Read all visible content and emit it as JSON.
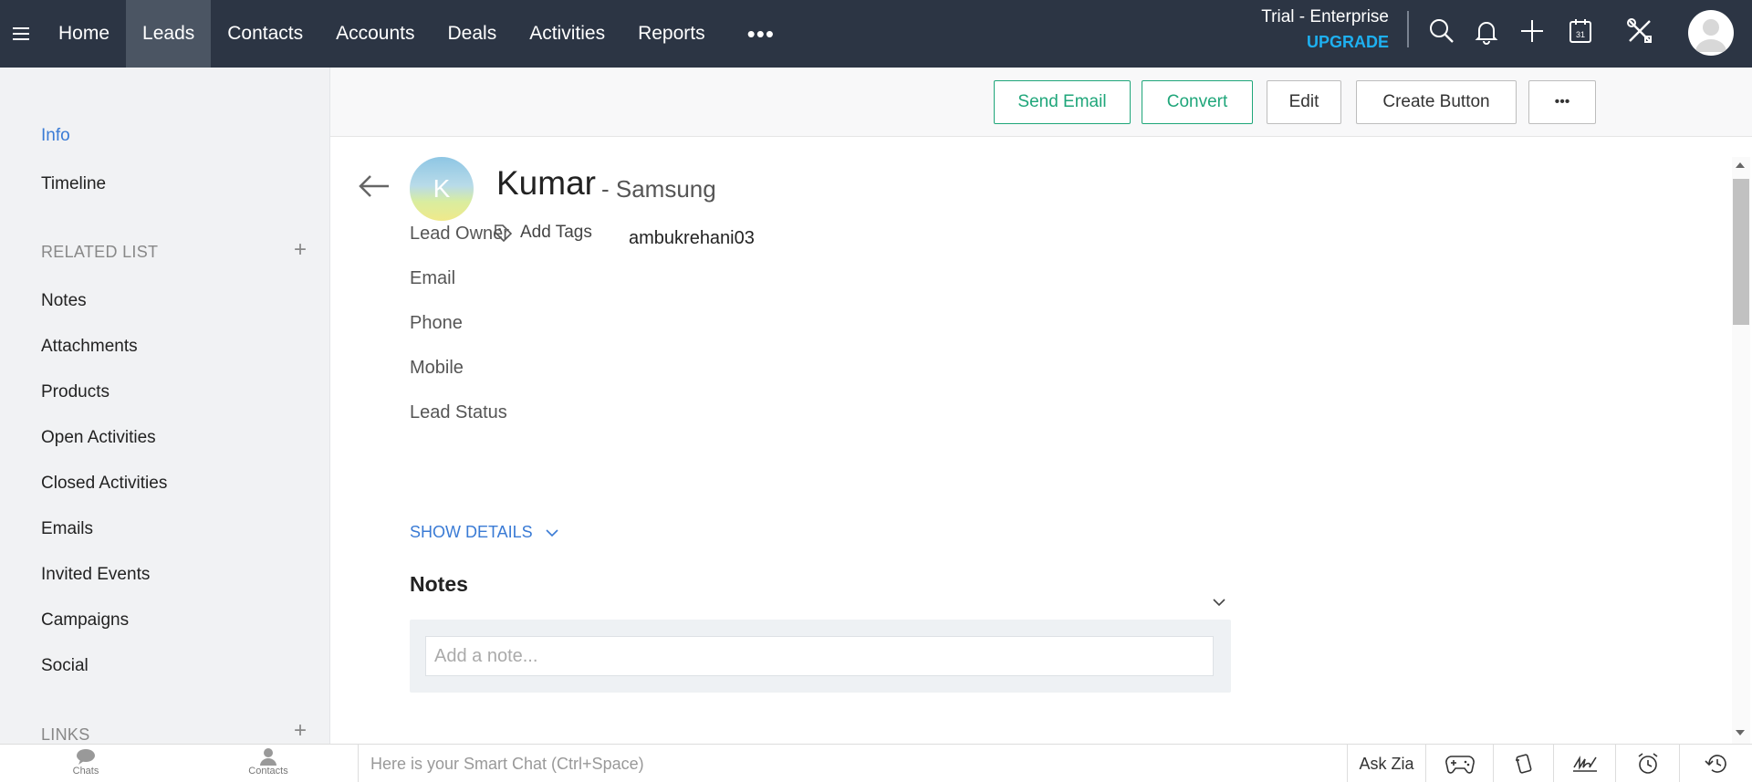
{
  "topnav": {
    "items": [
      {
        "label": "Home",
        "active": false
      },
      {
        "label": "Leads",
        "active": true
      },
      {
        "label": "Contacts",
        "active": false
      },
      {
        "label": "Accounts",
        "active": false
      },
      {
        "label": "Deals",
        "active": false
      },
      {
        "label": "Activities",
        "active": false
      },
      {
        "label": "Reports",
        "active": false
      }
    ],
    "more": "•••",
    "trial_label": "Trial - Enterprise",
    "upgrade_label": "UPGRADE",
    "icons": [
      "search-icon",
      "bell-icon",
      "plus-icon",
      "calendar-icon",
      "tools-icon"
    ],
    "calendar_day": "31"
  },
  "sidebar": {
    "info": "Info",
    "timeline": "Timeline",
    "related_list_title": "RELATED LIST",
    "related_items": [
      "Notes",
      "Attachments",
      "Products",
      "Open Activities",
      "Closed Activities",
      "Emails",
      "Invited Events",
      "Campaigns",
      "Social"
    ],
    "links_title": "LINKS"
  },
  "actions": {
    "send_email": "Send Email",
    "convert": "Convert",
    "edit": "Edit",
    "create_button": "Create Button",
    "more": "•••"
  },
  "lead": {
    "initial": "K",
    "name": "Kumar",
    "company": "- Samsung",
    "add_tags": "Add Tags",
    "fields": [
      {
        "label": "Lead Owner",
        "value": "ambukrehani03"
      },
      {
        "label": "Email",
        "value": ""
      },
      {
        "label": "Phone",
        "value": ""
      },
      {
        "label": "Mobile",
        "value": ""
      },
      {
        "label": "Lead Status",
        "value": ""
      }
    ],
    "show_details": "SHOW DETAILS"
  },
  "notes": {
    "title": "Notes",
    "placeholder": "Add a note..."
  },
  "bottombar": {
    "chats": "Chats",
    "contacts": "Contacts",
    "smartchat_placeholder": "Here is your Smart Chat (Ctrl+Space)",
    "ask_zia": "Ask Zia"
  },
  "colors": {
    "topbar": "#2c3544",
    "accent_blue": "#3a7bd5",
    "upgrade": "#1eb0f0",
    "green": "#1fa67a"
  }
}
